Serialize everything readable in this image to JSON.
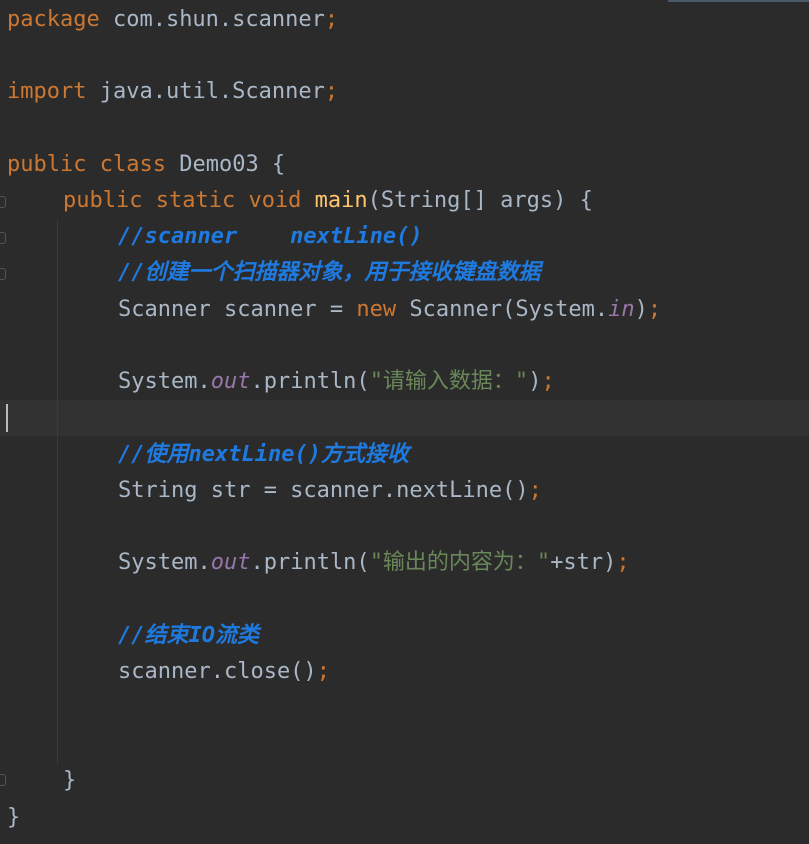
{
  "code": {
    "l1": {
      "kw": "package",
      "rest": " com.shun.scanner",
      "semi": ";"
    },
    "l2": {
      "kw": "import",
      "rest": " java.util.Scanner",
      "semi": ";"
    },
    "l3": {
      "kw1": "public",
      "kw2": " class",
      "rest": " Demo03 {"
    },
    "l4": {
      "kw1": "public",
      "kw2": " static",
      "kw3": " void",
      "fn": " main",
      "rest": "(String[] args) {"
    },
    "l5": {
      "comment": "//scanner    nextLine()"
    },
    "l6": {
      "comment": "//创建一个扫描器对象，用于接收键盘数据"
    },
    "l7": {
      "a": "Scanner scanner = ",
      "kw": "new",
      "b": " Scanner(System.",
      "field": "in",
      "c": ")",
      "semi": ";"
    },
    "l8": {
      "a": "System.",
      "field": "out",
      "b": ".println(",
      "str": "\"请输入数据：\"",
      "c": ")",
      "semi": ";"
    },
    "l9": {
      "comment": "//使用nextLine()方式接收"
    },
    "l10": {
      "a": "String str = scanner.nextLine()",
      "semi": ";"
    },
    "l11": {
      "a": "System.",
      "field": "out",
      "b": ".println(",
      "str": "\"输出的内容为：\"",
      "c": "+str)",
      "semi": ";"
    },
    "l12": {
      "comment": "//结束IO流类"
    },
    "l13": {
      "a": "scanner.close()",
      "semi": ";"
    },
    "l14": {
      "brace": "}"
    },
    "l15": {
      "brace": "}"
    }
  },
  "colors": {
    "background": "#2b2b2b",
    "keyword": "#cc7832",
    "function": "#ffc66d",
    "field": "#9876aa",
    "string": "#6a8759",
    "comment": "#1f7ae0",
    "text": "#a9b7c6"
  }
}
